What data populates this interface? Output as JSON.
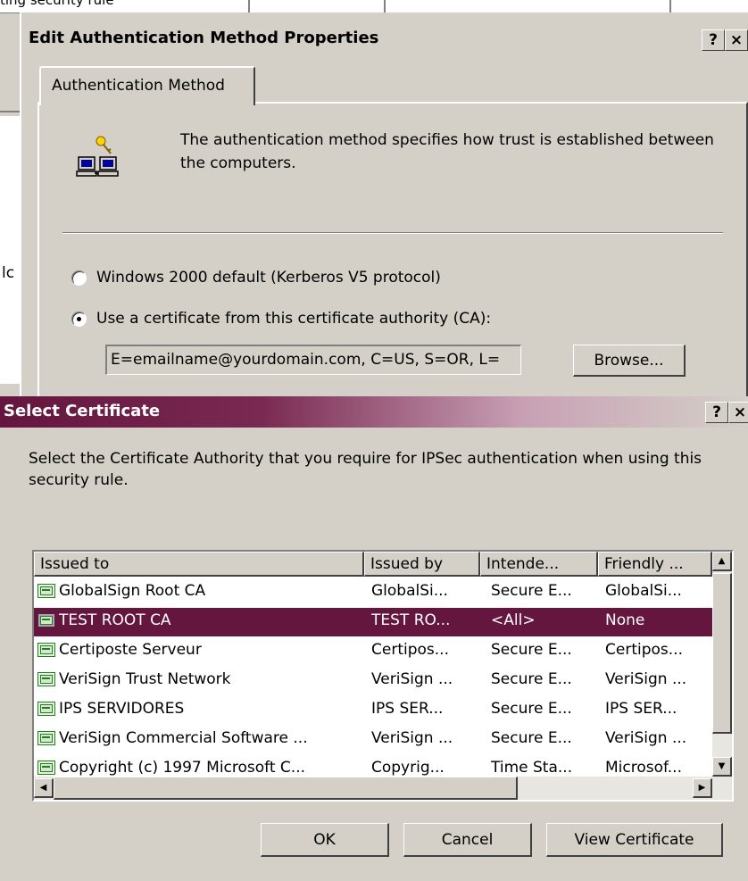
{
  "background": {
    "top_text": "ting security rule",
    "left_char": "lc"
  },
  "auth_window": {
    "title": "Edit Authentication Method Properties",
    "help_glyph": "?",
    "close_glyph": "×",
    "tab_label": "Authentication Method",
    "description": "The authentication method specifies how trust is established between the computers.",
    "icon": "computers-key-icon",
    "radio_kerberos": "Windows 2000 default (Kerberos V5 protocol)",
    "radio_certificate": "Use a certificate from this certificate authority (CA):",
    "selected_option": "certificate",
    "ca_value": "E=emailname@yourdomain.com, C=US, S=OR, L=",
    "browse_label": "Browse..."
  },
  "cert_window": {
    "title": "Select Certificate",
    "help_glyph": "?",
    "close_glyph": "×",
    "intro": "Select the Certificate Authority that you require for IPSec authentication when using this security rule.",
    "columns": [
      "Issued to",
      "Issued by",
      "Intende...",
      "Friendly ..."
    ],
    "rows": [
      [
        "GlobalSign Root CA",
        "GlobalSi...",
        "Secure E...",
        "GlobalSi..."
      ],
      [
        "TEST ROOT CA",
        "TEST RO...",
        "<All>",
        "None"
      ],
      [
        "Certiposte Serveur",
        "Certipos...",
        "Secure E...",
        "Certipos..."
      ],
      [
        "VeriSign Trust Network",
        "VeriSign ...",
        "Secure E...",
        "VeriSign ..."
      ],
      [
        "IPS SERVIDORES",
        "IPS SER...",
        "Secure E...",
        "IPS SER..."
      ],
      [
        "VeriSign Commercial Software ...",
        "VeriSign ...",
        "Secure E...",
        "VeriSign ..."
      ],
      [
        "Copyright (c) 1997 Microsoft C...",
        "Copyrig...",
        "Time Sta...",
        "Microsof..."
      ]
    ],
    "selected_row": 1,
    "ok_label": "OK",
    "cancel_label": "Cancel",
    "view_label": "View Certificate",
    "colors": {
      "selection": "#64163e",
      "title_start": "#64163e"
    }
  }
}
